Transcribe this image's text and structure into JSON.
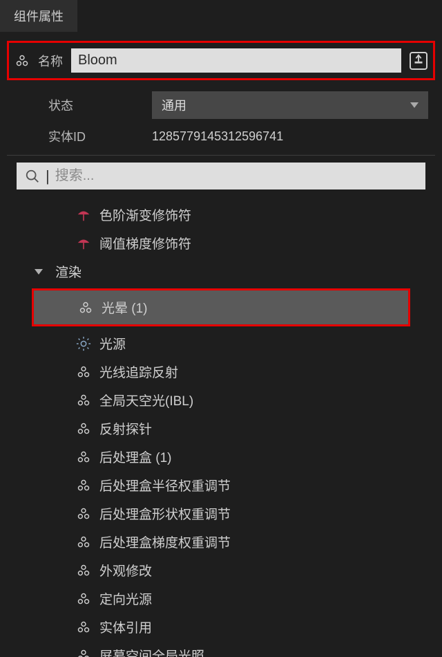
{
  "tab_title": "组件属性",
  "name": {
    "label": "名称",
    "value": "Bloom"
  },
  "status": {
    "label": "状态",
    "value": "通用"
  },
  "entity_id": {
    "label": "实体ID",
    "value": "1285779145312596741"
  },
  "search": {
    "placeholder": "搜索..."
  },
  "top_items": [
    {
      "icon": "umbrella-icon",
      "label": "色阶渐变修饰符"
    },
    {
      "icon": "umbrella-icon",
      "label": "阈值梯度修饰符"
    }
  ],
  "render_header": "渲染",
  "highlighted_item": {
    "icon": "cluster-icon",
    "label": "光晕 (1)"
  },
  "render_items": [
    {
      "icon": "sun-icon",
      "label": "光源"
    },
    {
      "icon": "cluster-icon",
      "label": "光线追踪反射"
    },
    {
      "icon": "cluster-icon",
      "label": "全局天空光(IBL)"
    },
    {
      "icon": "cluster-icon",
      "label": "反射探针"
    },
    {
      "icon": "cluster-icon",
      "label": "后处理盒 (1)"
    },
    {
      "icon": "cluster-icon",
      "label": "后处理盒半径权重调节"
    },
    {
      "icon": "cluster-icon",
      "label": "后处理盒形状权重调节"
    },
    {
      "icon": "cluster-icon",
      "label": "后处理盒梯度权重调节"
    },
    {
      "icon": "cluster-icon",
      "label": "外观修改"
    },
    {
      "icon": "cluster-icon",
      "label": "定向光源"
    },
    {
      "icon": "cluster-icon",
      "label": "实体引用"
    },
    {
      "icon": "cluster-icon",
      "label": "屏幕空间全局光照"
    }
  ]
}
